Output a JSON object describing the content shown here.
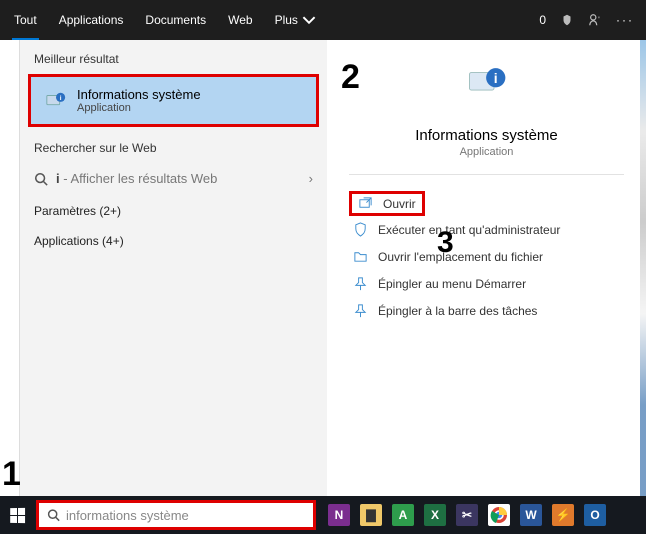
{
  "tabs": {
    "all": "Tout",
    "apps": "Applications",
    "docs": "Documents",
    "web": "Web",
    "more": "Plus"
  },
  "titlebar": {
    "zero": "0"
  },
  "left": {
    "best_header": "Meilleur résultat",
    "best_title": "Informations système",
    "best_sub": "Application",
    "web_header": "Rechercher sur le Web",
    "web_prefix": "i",
    "web_hint": " - Afficher les résultats Web",
    "settings": "Paramètres (2+)",
    "apps": "Applications (4+)"
  },
  "right": {
    "title": "Informations système",
    "sub": "Application",
    "actions": {
      "open": "Ouvrir",
      "admin": "Exécuter en tant qu'administrateur",
      "location": "Ouvrir l'emplacement du fichier",
      "pin_start": "Épingler au menu Démarrer",
      "pin_taskbar": "Épingler à la barre des tâches"
    }
  },
  "callouts": {
    "n1": "1",
    "n2": "2",
    "n3": "3"
  },
  "search": {
    "value": "informations système",
    "prefix": "i"
  }
}
